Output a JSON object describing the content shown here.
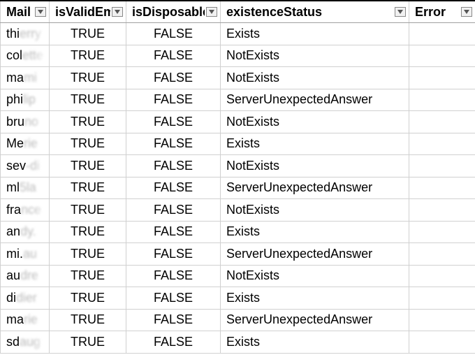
{
  "columns": {
    "mail": "Mail",
    "valid": "isValidEmail",
    "disp": "isDisposable",
    "exist": "existenceStatus",
    "error": "Error"
  },
  "rows": [
    {
      "mail_sharp": "thi",
      "mail_fuzzy": "erry",
      "valid": "TRUE",
      "disp": "FALSE",
      "exist": "Exists",
      "error": ""
    },
    {
      "mail_sharp": "col",
      "mail_fuzzy": "ette",
      "valid": "TRUE",
      "disp": "FALSE",
      "exist": "NotExists",
      "error": ""
    },
    {
      "mail_sharp": "ma",
      "mail_fuzzy": "mi",
      "valid": "TRUE",
      "disp": "FALSE",
      "exist": "NotExists",
      "error": ""
    },
    {
      "mail_sharp": "phi",
      "mail_fuzzy": "lip",
      "valid": "TRUE",
      "disp": "FALSE",
      "exist": "ServerUnexpectedAnswer",
      "error": ""
    },
    {
      "mail_sharp": "bru",
      "mail_fuzzy": "no",
      "valid": "TRUE",
      "disp": "FALSE",
      "exist": "NotExists",
      "error": ""
    },
    {
      "mail_sharp": "Me",
      "mail_fuzzy": "rie",
      "valid": "TRUE",
      "disp": "FALSE",
      "exist": "Exists",
      "error": ""
    },
    {
      "mail_sharp": "sev",
      "mail_fuzzy": "-di",
      "valid": "TRUE",
      "disp": "FALSE",
      "exist": "NotExists",
      "error": ""
    },
    {
      "mail_sharp": "ml",
      "mail_fuzzy": "5la",
      "valid": "TRUE",
      "disp": "FALSE",
      "exist": "ServerUnexpectedAnswer",
      "error": ""
    },
    {
      "mail_sharp": "fra",
      "mail_fuzzy": "nce",
      "valid": "TRUE",
      "disp": "FALSE",
      "exist": "NotExists",
      "error": ""
    },
    {
      "mail_sharp": "an",
      "mail_fuzzy": "dy.",
      "valid": "TRUE",
      "disp": "FALSE",
      "exist": "Exists",
      "error": ""
    },
    {
      "mail_sharp": "mi.",
      "mail_fuzzy": "au",
      "valid": "TRUE",
      "disp": "FALSE",
      "exist": "ServerUnexpectedAnswer",
      "error": ""
    },
    {
      "mail_sharp": "au",
      "mail_fuzzy": "dre",
      "valid": "TRUE",
      "disp": "FALSE",
      "exist": "NotExists",
      "error": ""
    },
    {
      "mail_sharp": "di",
      "mail_fuzzy": "dier",
      "valid": "TRUE",
      "disp": "FALSE",
      "exist": "Exists",
      "error": ""
    },
    {
      "mail_sharp": "ma",
      "mail_fuzzy": "rie",
      "valid": "TRUE",
      "disp": "FALSE",
      "exist": "ServerUnexpectedAnswer",
      "error": ""
    },
    {
      "mail_sharp": "sd",
      "mail_fuzzy": "aug",
      "valid": "TRUE",
      "disp": "FALSE",
      "exist": "Exists",
      "error": ""
    }
  ]
}
